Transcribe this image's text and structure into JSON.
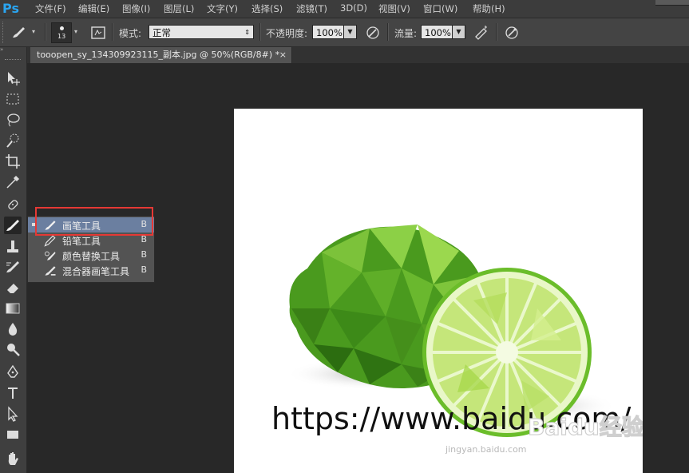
{
  "app": {
    "logo": "Ps"
  },
  "menu": [
    "文件(F)",
    "编辑(E)",
    "图像(I)",
    "图层(L)",
    "文字(Y)",
    "选择(S)",
    "滤镜(T)",
    "3D(D)",
    "视图(V)",
    "窗口(W)",
    "帮助(H)"
  ],
  "options": {
    "brush_size": "13",
    "mode_label": "模式:",
    "mode_value": "正常",
    "opacity_label": "不透明度:",
    "opacity_value": "100%",
    "flow_label": "流量:",
    "flow_value": "100%"
  },
  "tab": {
    "title": "tooopen_sy_134309923115_副本.jpg @ 50%(RGB/8#) *",
    "close": "×"
  },
  "flyout": {
    "items": [
      {
        "label": "画笔工具",
        "key": "B",
        "icon": "brush-icon",
        "active": true
      },
      {
        "label": "铅笔工具",
        "key": "B",
        "icon": "pencil-icon",
        "active": false
      },
      {
        "label": "颜色替换工具",
        "key": "B",
        "icon": "color-replacement-icon",
        "active": false
      },
      {
        "label": "混合器画笔工具",
        "key": "B",
        "icon": "mixer-brush-icon",
        "active": false
      }
    ]
  },
  "canvas": {
    "url_text": "https://www.baidu.com/",
    "watermark": "Baidu经验",
    "watermark_sub": "jingyan.baidu.com"
  },
  "colors": {
    "highlight": "#e53935",
    "logo": "#2aa5f0",
    "active_row": "#6b7fa0"
  },
  "tools": [
    "move-icon",
    "marquee-icon",
    "lasso-icon",
    "quick-select-icon",
    "crop-icon",
    "eyedropper-icon",
    "healing-icon",
    "brush-icon",
    "stamp-icon",
    "history-brush-icon",
    "eraser-icon",
    "gradient-icon",
    "blur-icon",
    "dodge-icon",
    "pen-icon",
    "type-icon",
    "path-select-icon",
    "rectangle-icon",
    "hand-icon"
  ]
}
